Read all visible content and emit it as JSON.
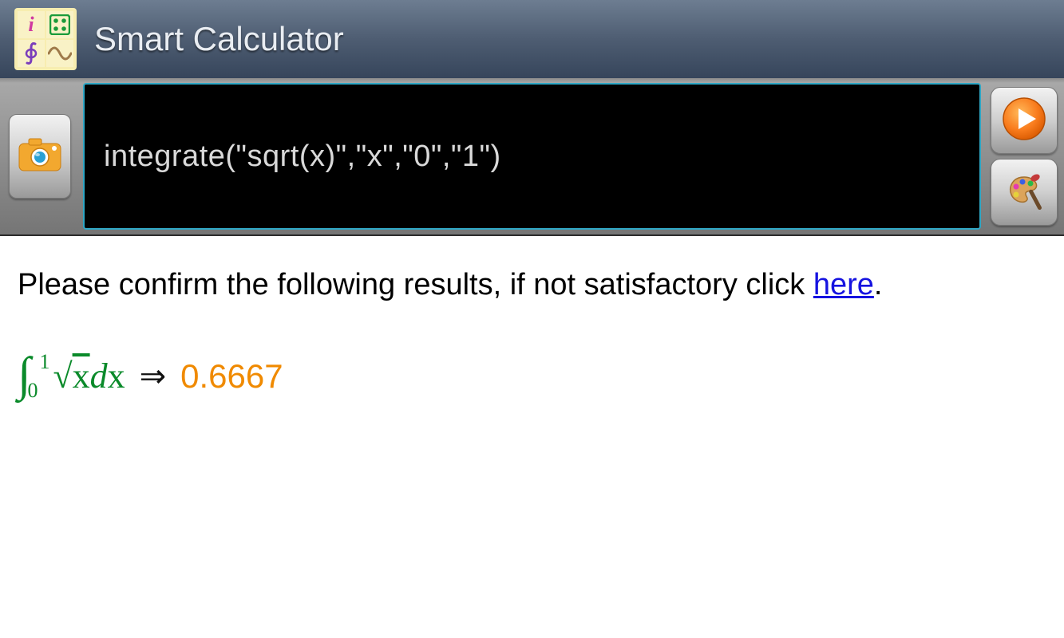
{
  "header": {
    "title": "Smart Calculator",
    "icon_cells": {
      "info": "i",
      "grid": "grid-dots-icon",
      "integral": "phi-integral-icon",
      "wave": "sine-wave-icon"
    }
  },
  "toolbar": {
    "camera_icon": "camera-icon",
    "play_icon": "play-icon",
    "palette_icon": "palette-icon"
  },
  "input": {
    "expression": "integrate(\"sqrt(x)\",\"x\",\"0\",\"1\")"
  },
  "result": {
    "confirm_text_prefix": "Please confirm the following results, if not satisfactory click ",
    "confirm_link_text": "here",
    "confirm_text_suffix": ".",
    "integral_lower": "0",
    "integral_upper": "1",
    "radicand": "x",
    "differential_d": "d",
    "differential_var": "x",
    "arrow": "⇒",
    "value": "0.6667"
  },
  "colors": {
    "header_grad_top": "#6d7d91",
    "header_grad_bottom": "#36455b",
    "input_border": "#2ea7c6",
    "expr_green": "#0a8a2a",
    "answer_orange": "#f08a00",
    "link_blue": "#1613e0"
  }
}
